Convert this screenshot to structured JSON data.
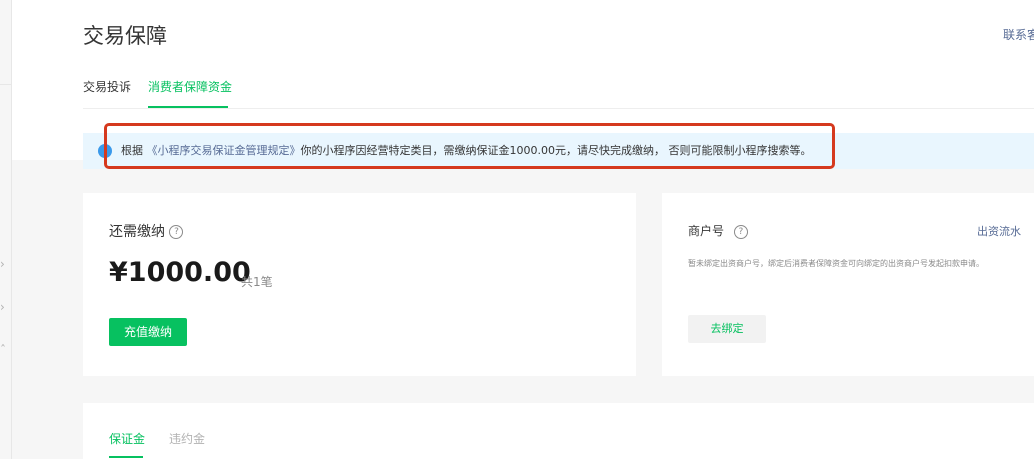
{
  "header": {
    "title": "交易保障",
    "contact": "联系客"
  },
  "tabs": [
    {
      "label": "交易投诉",
      "active": false
    },
    {
      "label": "消费者保障资金",
      "active": true
    }
  ],
  "notice": {
    "prefix": "根据",
    "link": "《小程序交易保证金管理规定》",
    "suffix": "你的小程序因经营特定类目，需缴纳保证金1000.00元，请尽快完成缴纳， 否则可能限制小程序搜索等。"
  },
  "due_card": {
    "label": "还需缴纳",
    "amount": "¥1000.00",
    "count": "共1笔",
    "button": "充值缴纳"
  },
  "merchant_card": {
    "label": "商户号",
    "link": "出资流水",
    "description": "暂未绑定出资商户号，绑定后消费者保障资金可向绑定的出资商户号发起扣款申请。",
    "button": "去绑定"
  },
  "bottom_tabs": [
    {
      "label": "保证金",
      "active": true
    },
    {
      "label": "违约金",
      "active": false
    }
  ],
  "colors": {
    "accent": "#07c160",
    "link": "#576b95",
    "notice_bg": "#e9f6fe",
    "info_icon": "#3a99ea",
    "highlight": "#d5391e"
  },
  "icons": {
    "info": "info-circle-icon",
    "help": "question-circle-icon",
    "nav": "chevron-icon"
  }
}
